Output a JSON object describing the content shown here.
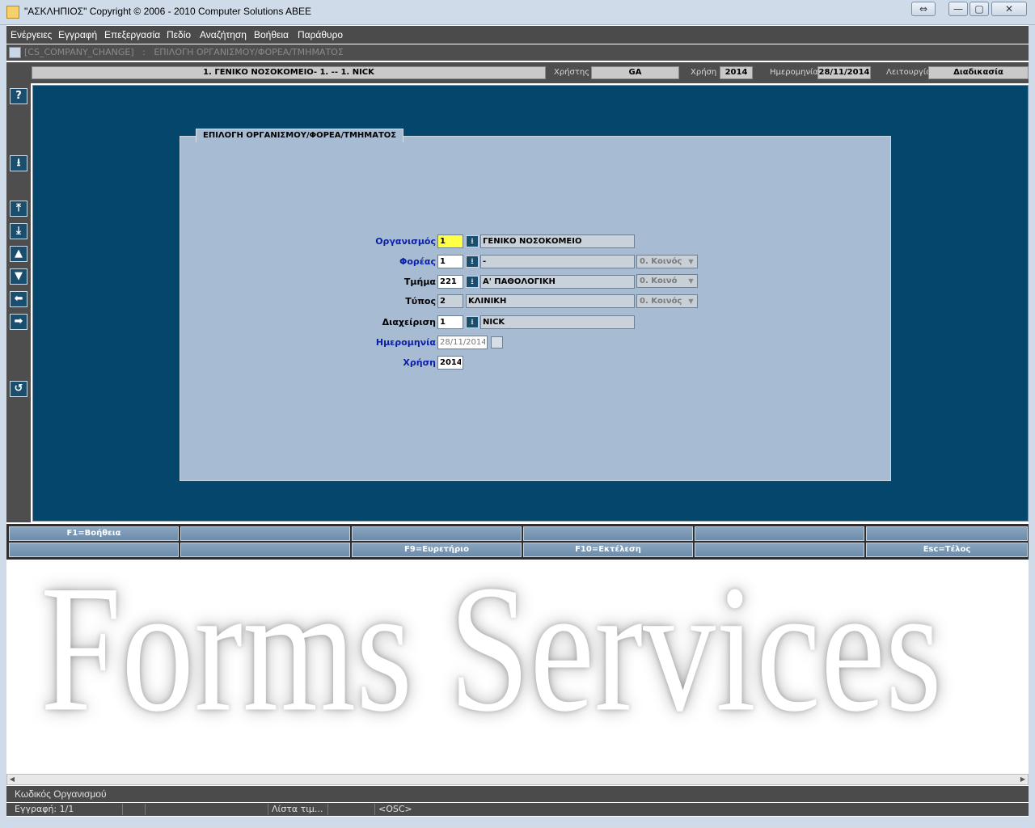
{
  "window": {
    "title": "\"ΑΣΚΛΗΠΙΟΣ\" Copyright © 2006 - 2010 Computer Solutions ABEE",
    "controls": {
      "restore": "⇔",
      "minimize": "—",
      "maximize": "▢",
      "close": "✕"
    }
  },
  "menu": [
    "Ενέργειες",
    "Εγγραφή",
    "Επεξεργασία",
    "Πεδίο",
    "Αναζήτηση",
    "Βοήθεια",
    "Παράθυρο"
  ],
  "path": "[CS_COMPANY_CHANGE]   :   ΕΠΙΛΟΓΗ ΟΡΓΑΝΙΣΜΟΥ/ΦΟΡΕΑ/ΤΜΗΜΑΤΟΣ",
  "info": {
    "org_display": "1. ΓΕΝΙΚΟ ΝΟΣΟΚΟΜΕΙΟ- 1. -- 1. NICK",
    "user_label": "Χρήστης",
    "user_value": "GA",
    "year_label": "Χρήση",
    "year_value": "2014",
    "date_label": "Ημερομηνία",
    "date_value": "28/11/2014",
    "function_label": "Λειτουργία",
    "function_value": "Διαδικασία"
  },
  "toolbar": {
    "help": "?",
    "download": "⭳",
    "first": "⤒",
    "last": "⤓",
    "prev": "▲",
    "next": "▼",
    "left": "⬅",
    "right": "➡",
    "undo": "↺"
  },
  "panel": {
    "title": "ΕΠΙΛΟΓΗ ΟΡΓΑΝΙΣΜΟΥ/ΦΟΡΕΑ/ΤΜΗΜΑΤΟΣ",
    "fields": {
      "organismos": {
        "label": "Οργανισμός",
        "code": "1",
        "desc": "ΓΕΝΙΚΟ ΝΟΣΟΚΟΜΕΙΟ"
      },
      "foreas": {
        "label": "Φορέας",
        "code": "1",
        "desc": "-",
        "combo": "0. Κοινός"
      },
      "tmima": {
        "label": "Τμήμα",
        "code": "221",
        "desc": "Α' ΠΑΘΟΛΟΓΙΚΗ",
        "combo": "0. Κοινό"
      },
      "typos": {
        "label": "Τύπος",
        "code": "2",
        "desc": "ΚΛΙΝΙΚΗ",
        "combo": "0. Κοινός"
      },
      "diaxeirisi": {
        "label": "Διαχείριση",
        "code": "1",
        "desc": "NICK"
      },
      "imerominia": {
        "label": "Ημερομηνία",
        "value": "28/11/2014"
      },
      "xrisi": {
        "label": "Χρήση",
        "value": "2014"
      }
    },
    "lov_icon": "⭳"
  },
  "fkeys": {
    "row1": [
      "F1=Βοήθεια",
      "",
      "",
      "",
      "",
      ""
    ],
    "row2": [
      "",
      "",
      "F9=Ευρετήριο",
      "F10=Εκτέλεση",
      "",
      "Esc=Τέλος"
    ]
  },
  "watermark": "Forms Services",
  "scroll": {
    "left": "◀",
    "right": "▶"
  },
  "status": {
    "message": "Κωδικός Οργανισμού",
    "record": "Εγγραφή: 1/1",
    "cell2": "",
    "cell3": "",
    "lov": "Λίστα τιμ...",
    "cell5": "",
    "mode": "<OSC>"
  },
  "colors": {
    "canvas": "#05476c",
    "panel": "#a7bcd2",
    "focus_field": "#ffff45",
    "label_blue": "#0a1ea8"
  }
}
